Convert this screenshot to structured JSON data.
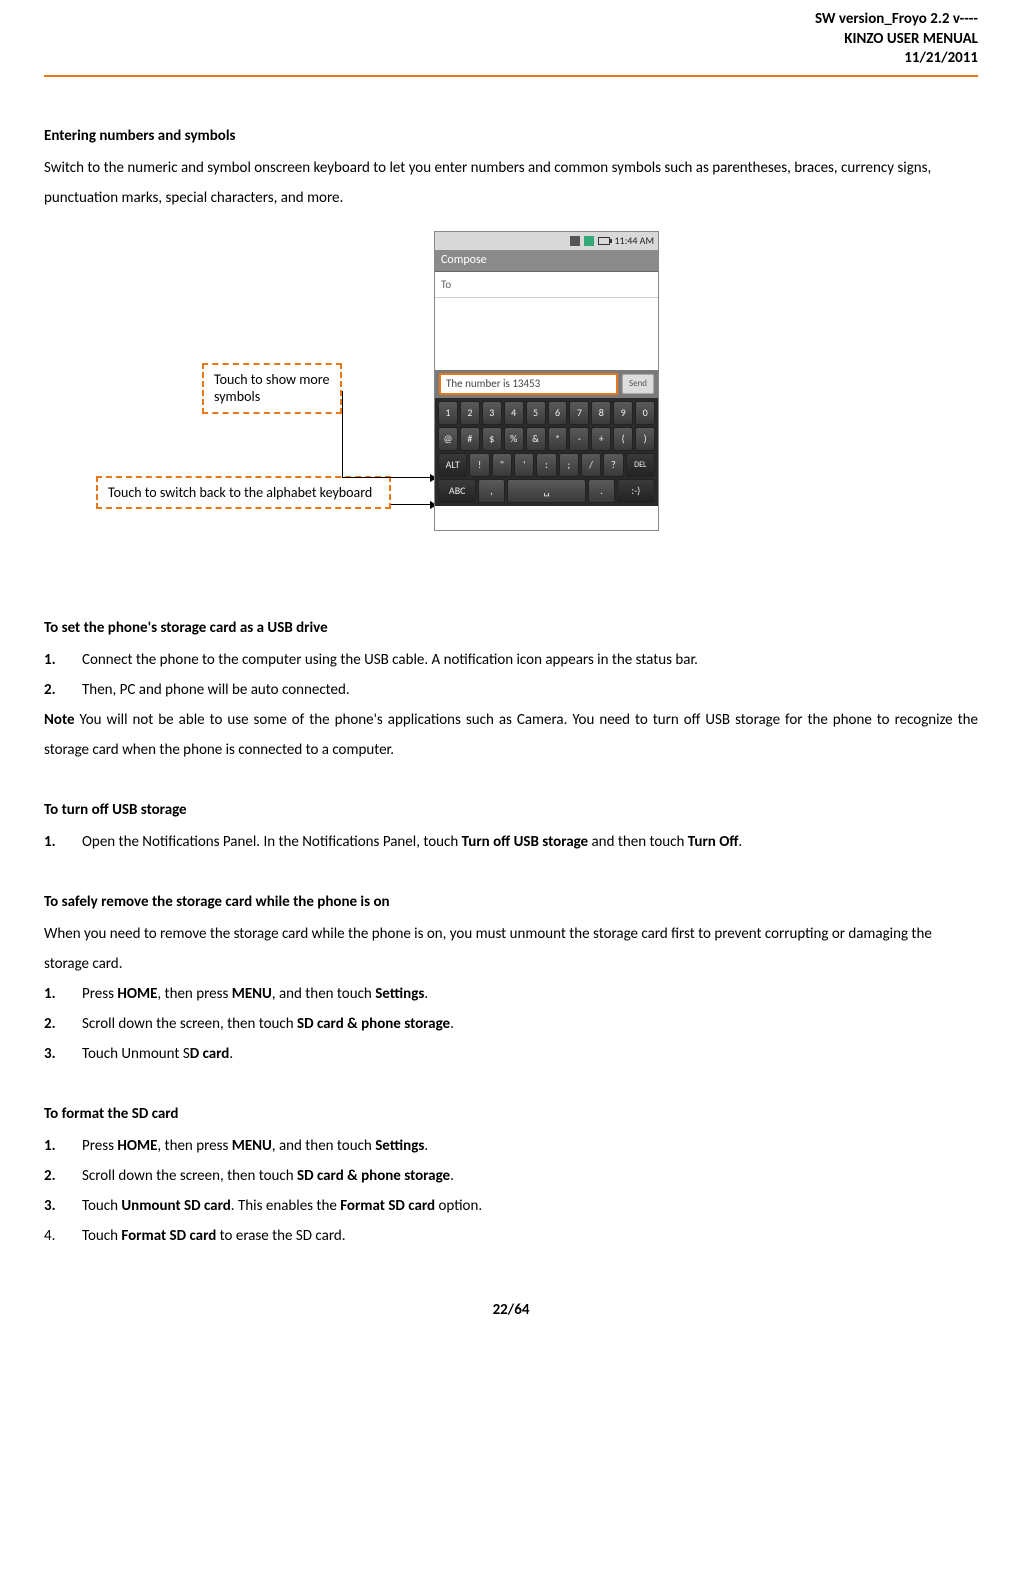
{
  "header": {
    "line1": "SW version_Froyo 2.2 v----",
    "line2": "KINZO USER MENUAL",
    "line3": "11/21/2011"
  },
  "section1": {
    "title": "Entering numbers and symbols",
    "body": "Switch to the numeric and symbol onscreen keyboard to let you enter numbers and common symbols such as parentheses, braces, currency signs, punctuation marks, special characters, and more."
  },
  "figure": {
    "callout1": "Touch to show more symbols",
    "callout2": "Touch to switch back to the alphabet keyboard",
    "phone": {
      "time": "11:44 AM",
      "appTitle": "Compose",
      "toLabel": "To",
      "inputText": "The number is 13453",
      "sendLabel": "Send",
      "row1": [
        "1",
        "2",
        "3",
        "4",
        "5",
        "6",
        "7",
        "8",
        "9",
        "0"
      ],
      "row2": [
        "@",
        "#",
        "$",
        "%",
        "&",
        "*",
        "-",
        "+",
        "(",
        ")"
      ],
      "row3": [
        "ALT",
        "!",
        "\"",
        "'",
        ":",
        ";",
        "/",
        "?",
        "DEL"
      ],
      "row4": [
        "ABC",
        ",",
        "␣",
        ".",
        ":-)"
      ]
    }
  },
  "section2": {
    "title": "To set the phone's storage card as a USB drive",
    "step1": "Connect the phone to the computer using the USB cable. A notification icon appears in the status bar.",
    "step2": "Then, PC and phone will be auto connected.",
    "noteLabel": "Note",
    "noteBody": " You will not be able to use some of the phone's applications such as Camera. You need to turn off USB storage for the phone to recognize the storage card when the phone is connected to a computer."
  },
  "section3": {
    "title": "To turn off USB storage",
    "step1_a": "Open the Notifications Panel.   In the Notifications Panel, touch ",
    "step1_b": "Turn off USB storage",
    "step1_c": " and then touch ",
    "step1_d": "Turn Off",
    "step1_e": "."
  },
  "section4": {
    "title": "To safely remove the storage card while the phone is on",
    "intro": "When you need to remove the storage card while the phone is on, you must unmount the storage card first to prevent corrupting or damaging the storage card.",
    "s1a": "Press ",
    "s1b": "HOME",
    "s1c": ", then press ",
    "s1d": "MENU",
    "s1e": ", and then touch ",
    "s1f": "Settings",
    "s1g": ".",
    "s2a": "Scroll down the screen, then touch ",
    "s2b": "SD card & phone storage",
    "s2c": ".",
    "s3a": "Touch Unmount S",
    "s3b": "D card",
    "s3c": "."
  },
  "section5": {
    "title": "To format the SD card",
    "s1a": "Press ",
    "s1b": "HOME",
    "s1c": ", then press ",
    "s1d": "MENU",
    "s1e": ", and then touch ",
    "s1f": "Settings",
    "s1g": ".",
    "s2a": "Scroll down the screen, then touch ",
    "s2b": "SD card & phone storage",
    "s2c": ".",
    "s3a": "Touch ",
    "s3b": "Unmount SD card",
    "s3c": ". This enables the ",
    "s3d": "Format SD card",
    "s3e": " option.",
    "s4a": "Touch ",
    "s4b": "Format SD card",
    "s4c": " to erase the SD card."
  },
  "footer": {
    "page": "22/64"
  }
}
